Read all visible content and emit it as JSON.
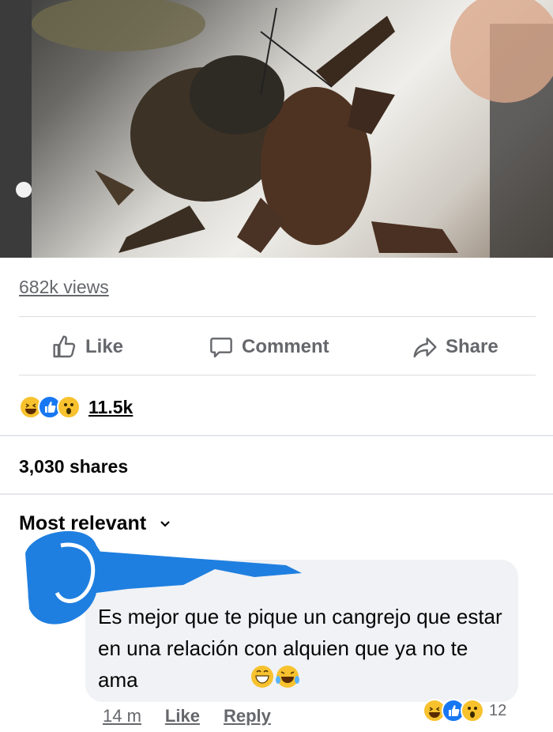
{
  "video": {
    "alt": "crabs in a container"
  },
  "stats": {
    "views": "682k views",
    "reaction_count": "11.5k",
    "shares": "3,030 shares"
  },
  "actions": {
    "like": "Like",
    "comment": "Comment",
    "share": "Share"
  },
  "sort": {
    "label": "Most relevant"
  },
  "comment": {
    "text": "Es mejor que te pique un cangrejo que estar en una relación con alquien que ya no te ama",
    "time": "14 m",
    "like": "Like",
    "reply": "Reply",
    "reaction_count": "12"
  },
  "colors": {
    "accent": "#1877f2",
    "muted": "#65676b",
    "bubble": "#f0f2f5",
    "scribble": "#1f7fe0"
  }
}
